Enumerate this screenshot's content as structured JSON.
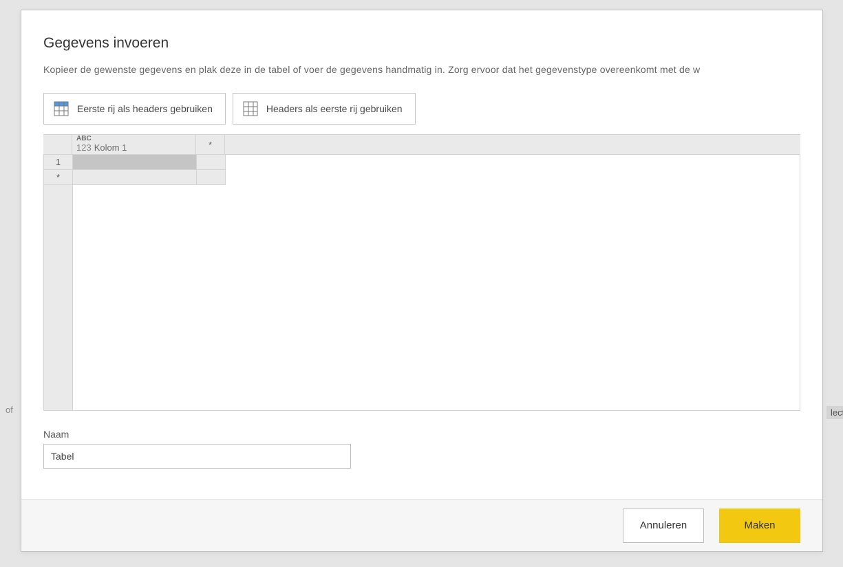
{
  "background": {
    "left_fragment": "of",
    "right_fragment": "lect"
  },
  "dialog": {
    "title": "Gegevens invoeren",
    "description": "Kopieer de gewenste gegevens en plak deze in de tabel of voer de gegevens handmatig in. Zorg ervoor dat het gegevenstype overeenkomt met de w",
    "buttons": {
      "first_row_as_headers": "Eerste rij als headers gebruiken",
      "headers_as_first_row": "Headers als eerste rij gebruiken"
    },
    "grid": {
      "column_type_badge": "ABC",
      "column_type_sub": "123",
      "column_name": "Kolom 1",
      "new_col_marker": "*",
      "row_number": "1",
      "new_row_marker": "*",
      "cell_value": ""
    },
    "name_label": "Naam",
    "name_value": "Tabel",
    "footer": {
      "cancel": "Annuleren",
      "create": "Maken"
    }
  }
}
